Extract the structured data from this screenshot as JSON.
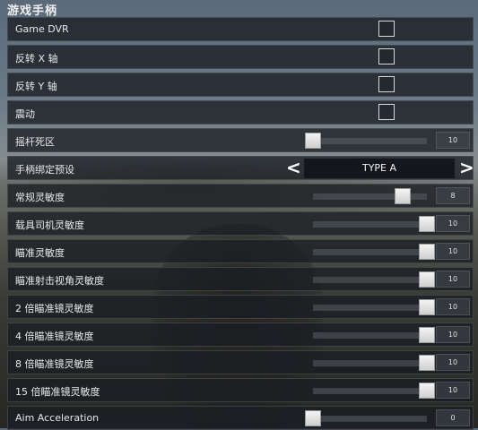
{
  "title": "游戏手柄",
  "rows": [
    {
      "id": "game-dvr",
      "label": "Game DVR",
      "type": "checkbox",
      "checked": false
    },
    {
      "id": "invert-x",
      "label": "反转 X 轴",
      "type": "checkbox",
      "checked": false
    },
    {
      "id": "invert-y",
      "label": "反转 Y 轴",
      "type": "checkbox",
      "checked": false
    },
    {
      "id": "vibration",
      "label": "震动",
      "type": "checkbox",
      "checked": false
    },
    {
      "id": "stick-deadzone",
      "label": "摇杆死区",
      "type": "slider",
      "value": "10",
      "fraction": 0.0
    },
    {
      "id": "controller-preset",
      "label": "手柄绑定预设",
      "type": "selector",
      "value": "TYPE A",
      "prev": "<",
      "next": ">"
    },
    {
      "id": "general-sensitivity",
      "label": "常规灵敏度",
      "type": "slider",
      "value": "8",
      "fraction": 0.79
    },
    {
      "id": "vehicle-driver-sensitivity",
      "label": "载具司机灵敏度",
      "type": "slider",
      "value": "10",
      "fraction": 1.0
    },
    {
      "id": "aim-sensitivity",
      "label": "瞄准灵敏度",
      "type": "slider",
      "value": "10",
      "fraction": 1.0
    },
    {
      "id": "ads-sensitivity",
      "label": "瞄准射击视角灵敏度",
      "type": "slider",
      "value": "10",
      "fraction": 1.0
    },
    {
      "id": "scope-2x-sensitivity",
      "label": "2 倍瞄准镜灵敏度",
      "type": "slider",
      "value": "10",
      "fraction": 1.0
    },
    {
      "id": "scope-4x-sensitivity",
      "label": "4 倍瞄准镜灵敏度",
      "type": "slider",
      "value": "10",
      "fraction": 1.0
    },
    {
      "id": "scope-8x-sensitivity",
      "label": "8 倍瞄准镜灵敏度",
      "type": "slider",
      "value": "10",
      "fraction": 1.0
    },
    {
      "id": "scope-15x-sensitivity",
      "label": "15 倍瞄准镜灵敏度",
      "type": "slider",
      "value": "10",
      "fraction": 1.0
    },
    {
      "id": "aim-acceleration",
      "label": "Aim Acceleration",
      "type": "slider",
      "value": "0",
      "fraction": 0.0
    }
  ]
}
